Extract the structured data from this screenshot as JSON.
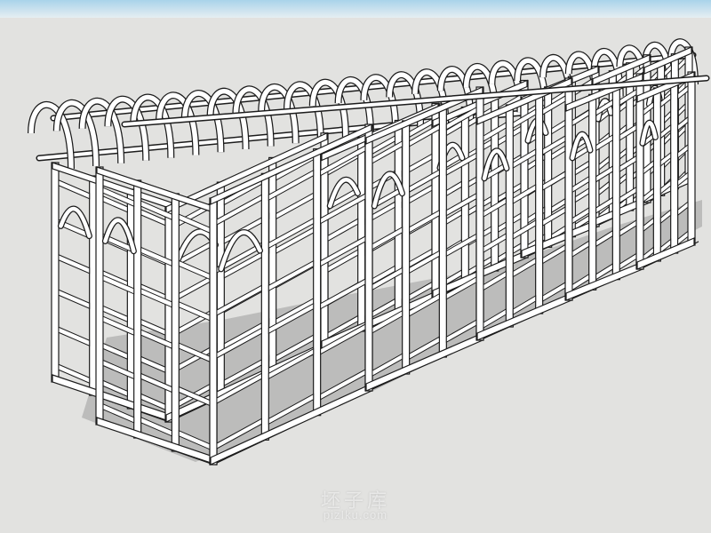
{
  "scene": {
    "subject": "arched-garden-trellis-arcade",
    "colors": {
      "sky_top": "#a9d3ea",
      "sky_bottom": "#e6eef2",
      "ground": "#e2e2e0",
      "frame_fill": "#ffffff",
      "frame_stroke": "#1c1c1c",
      "shadow": "#9d9d9d",
      "frame_side": "#cfcfcf"
    }
  },
  "watermark": {
    "cn": "坯子库",
    "en": "pizIku.com"
  }
}
